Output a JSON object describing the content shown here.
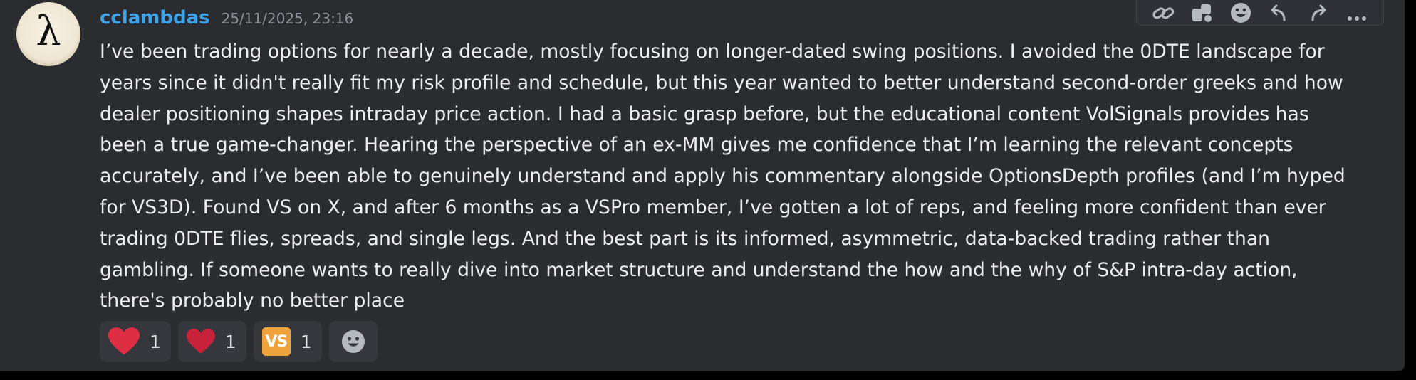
{
  "message": {
    "username": "cclambdas",
    "timestamp": "25/11/2025, 23:16",
    "avatar_glyph": "λ",
    "lines": [
      "I’ve been trading options for nearly a decade, mostly focusing on longer-dated swing positions. I avoided the 0DTE landscape for",
      "years since it didn't really fit my risk profile and schedule, but this year wanted to better understand second-order greeks and how",
      "dealer positioning shapes intraday price action. I had a basic grasp before, but the educational content VolSignals provides has",
      "been a true game-changer. Hearing the perspective of an ex-MM gives me confidence that I’m learning the relevant concepts",
      "accurately, and I’ve been able to genuinely understand and apply his commentary alongside OptionsDepth profiles (and I’m hyped",
      "for VS3D). Found VS on X, and after 6 months as a VSPro member, I’ve gotten a lot of reps, and feeling more confident than ever",
      "trading 0DTE flies, spreads, and single legs. And the best part is its informed, asymmetric, data-backed trading rather than",
      "gambling. If someone wants to really dive into market structure and understand the how and the why of S&P intra-day action,",
      "there's probably no better place"
    ]
  },
  "reactions": [
    {
      "icon": "heart-icon",
      "count": "1",
      "color": "#dd2e44"
    },
    {
      "icon": "heart-icon",
      "count": "1",
      "color": "#c8223a"
    },
    {
      "icon": "vs-emoji-icon",
      "label": "VS",
      "count": "1",
      "color": "#f0a23a"
    }
  ],
  "toolbar": {
    "icons": [
      "link-icon",
      "app-icon",
      "emoji-icon",
      "reply-icon",
      "forward-icon",
      "more-icon"
    ]
  },
  "colors": {
    "background": "#2b2c30",
    "username": "#3fa3ea",
    "timestamp": "#8e9099",
    "text": "#ededf0",
    "reaction_bg": "#35373c"
  }
}
